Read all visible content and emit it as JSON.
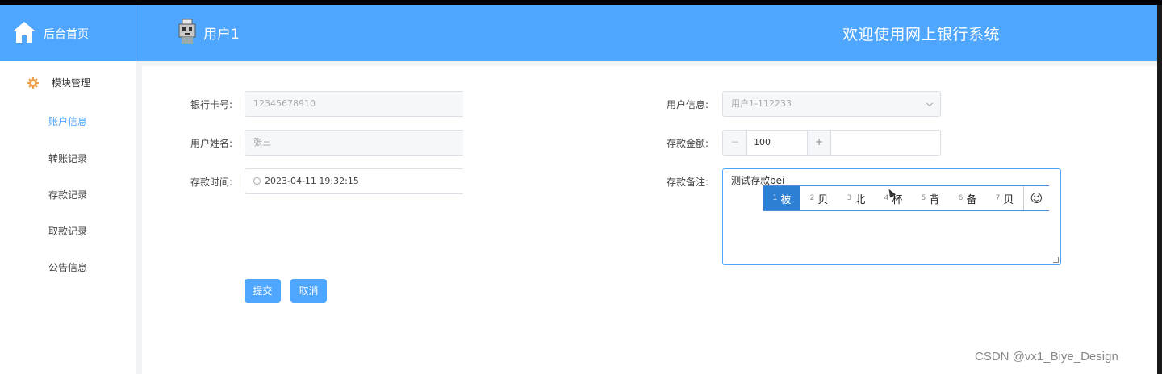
{
  "header": {
    "home_label": "后台首页",
    "user_label": "用户1",
    "welcome": "欢迎使用网上银行系统"
  },
  "sidebar": {
    "module_label": "模块管理",
    "items": [
      {
        "label": "账户信息",
        "active": true
      },
      {
        "label": "转账记录"
      },
      {
        "label": "存款记录"
      },
      {
        "label": "取款记录"
      },
      {
        "label": "公告信息"
      }
    ]
  },
  "form": {
    "card_no_label": "银行卡号:",
    "card_no_value": "12345678910",
    "user_name_label": "用户姓名:",
    "user_name_value": "张三",
    "deposit_time_label": "存款时间:",
    "deposit_time_value": "2023-04-11 19:32:15",
    "user_info_label": "用户信息:",
    "user_info_value": "用户1-112233",
    "amount_label": "存款金额:",
    "amount_value": "100",
    "amount_minus": "−",
    "amount_plus": "+",
    "remark_label": "存款备注:",
    "remark_value": "测试存款bei"
  },
  "ime": {
    "candidates": [
      {
        "n": "1",
        "text": "被",
        "selected": true
      },
      {
        "n": "2",
        "text": "贝"
      },
      {
        "n": "3",
        "text": "北"
      },
      {
        "n": "4",
        "text": "杯"
      },
      {
        "n": "5",
        "text": "背"
      },
      {
        "n": "6",
        "text": "备"
      },
      {
        "n": "7",
        "text": "贝"
      }
    ],
    "emoji": "☺"
  },
  "buttons": {
    "submit": "提交",
    "cancel": "取消"
  },
  "watermark": "CSDN @vx1_Biye_Design",
  "colors": {
    "primary": "#4ea6ff",
    "ime_selected": "#2d7fd3",
    "module_icon": "#f0a04b"
  }
}
